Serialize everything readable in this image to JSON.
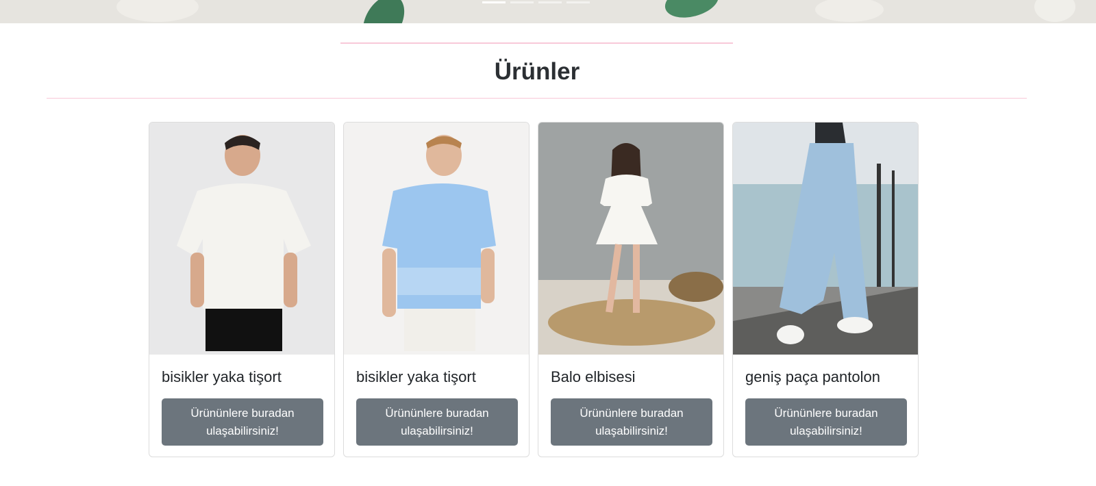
{
  "hero": {
    "slide_count": 4,
    "active_slide": 1
  },
  "section": {
    "title": "Ürünler"
  },
  "products": [
    {
      "name": "bisikler yaka tişort",
      "button_label": "Ürününlere buradan ulaşabilirsiniz!",
      "image": "man-white-tshirt-photo"
    },
    {
      "name": "bisikler yaka tişort",
      "button_label": "Ürününlere buradan ulaşabilirsiniz!",
      "image": "man-blue-tshirt-photo"
    },
    {
      "name": "Balo elbisesi",
      "button_label": "Ürününlere buradan ulaşabilirsiniz!",
      "image": "woman-white-dress-photo"
    },
    {
      "name": "geniş paça pantolon",
      "button_label": "Ürününlere buradan ulaşabilirsiniz!",
      "image": "wide-leg-jeans-photo"
    }
  ],
  "colors": {
    "button_bg": "#6c757d",
    "accent_rule": "#f8c8d8",
    "hero_bg": "#e6e4df"
  }
}
